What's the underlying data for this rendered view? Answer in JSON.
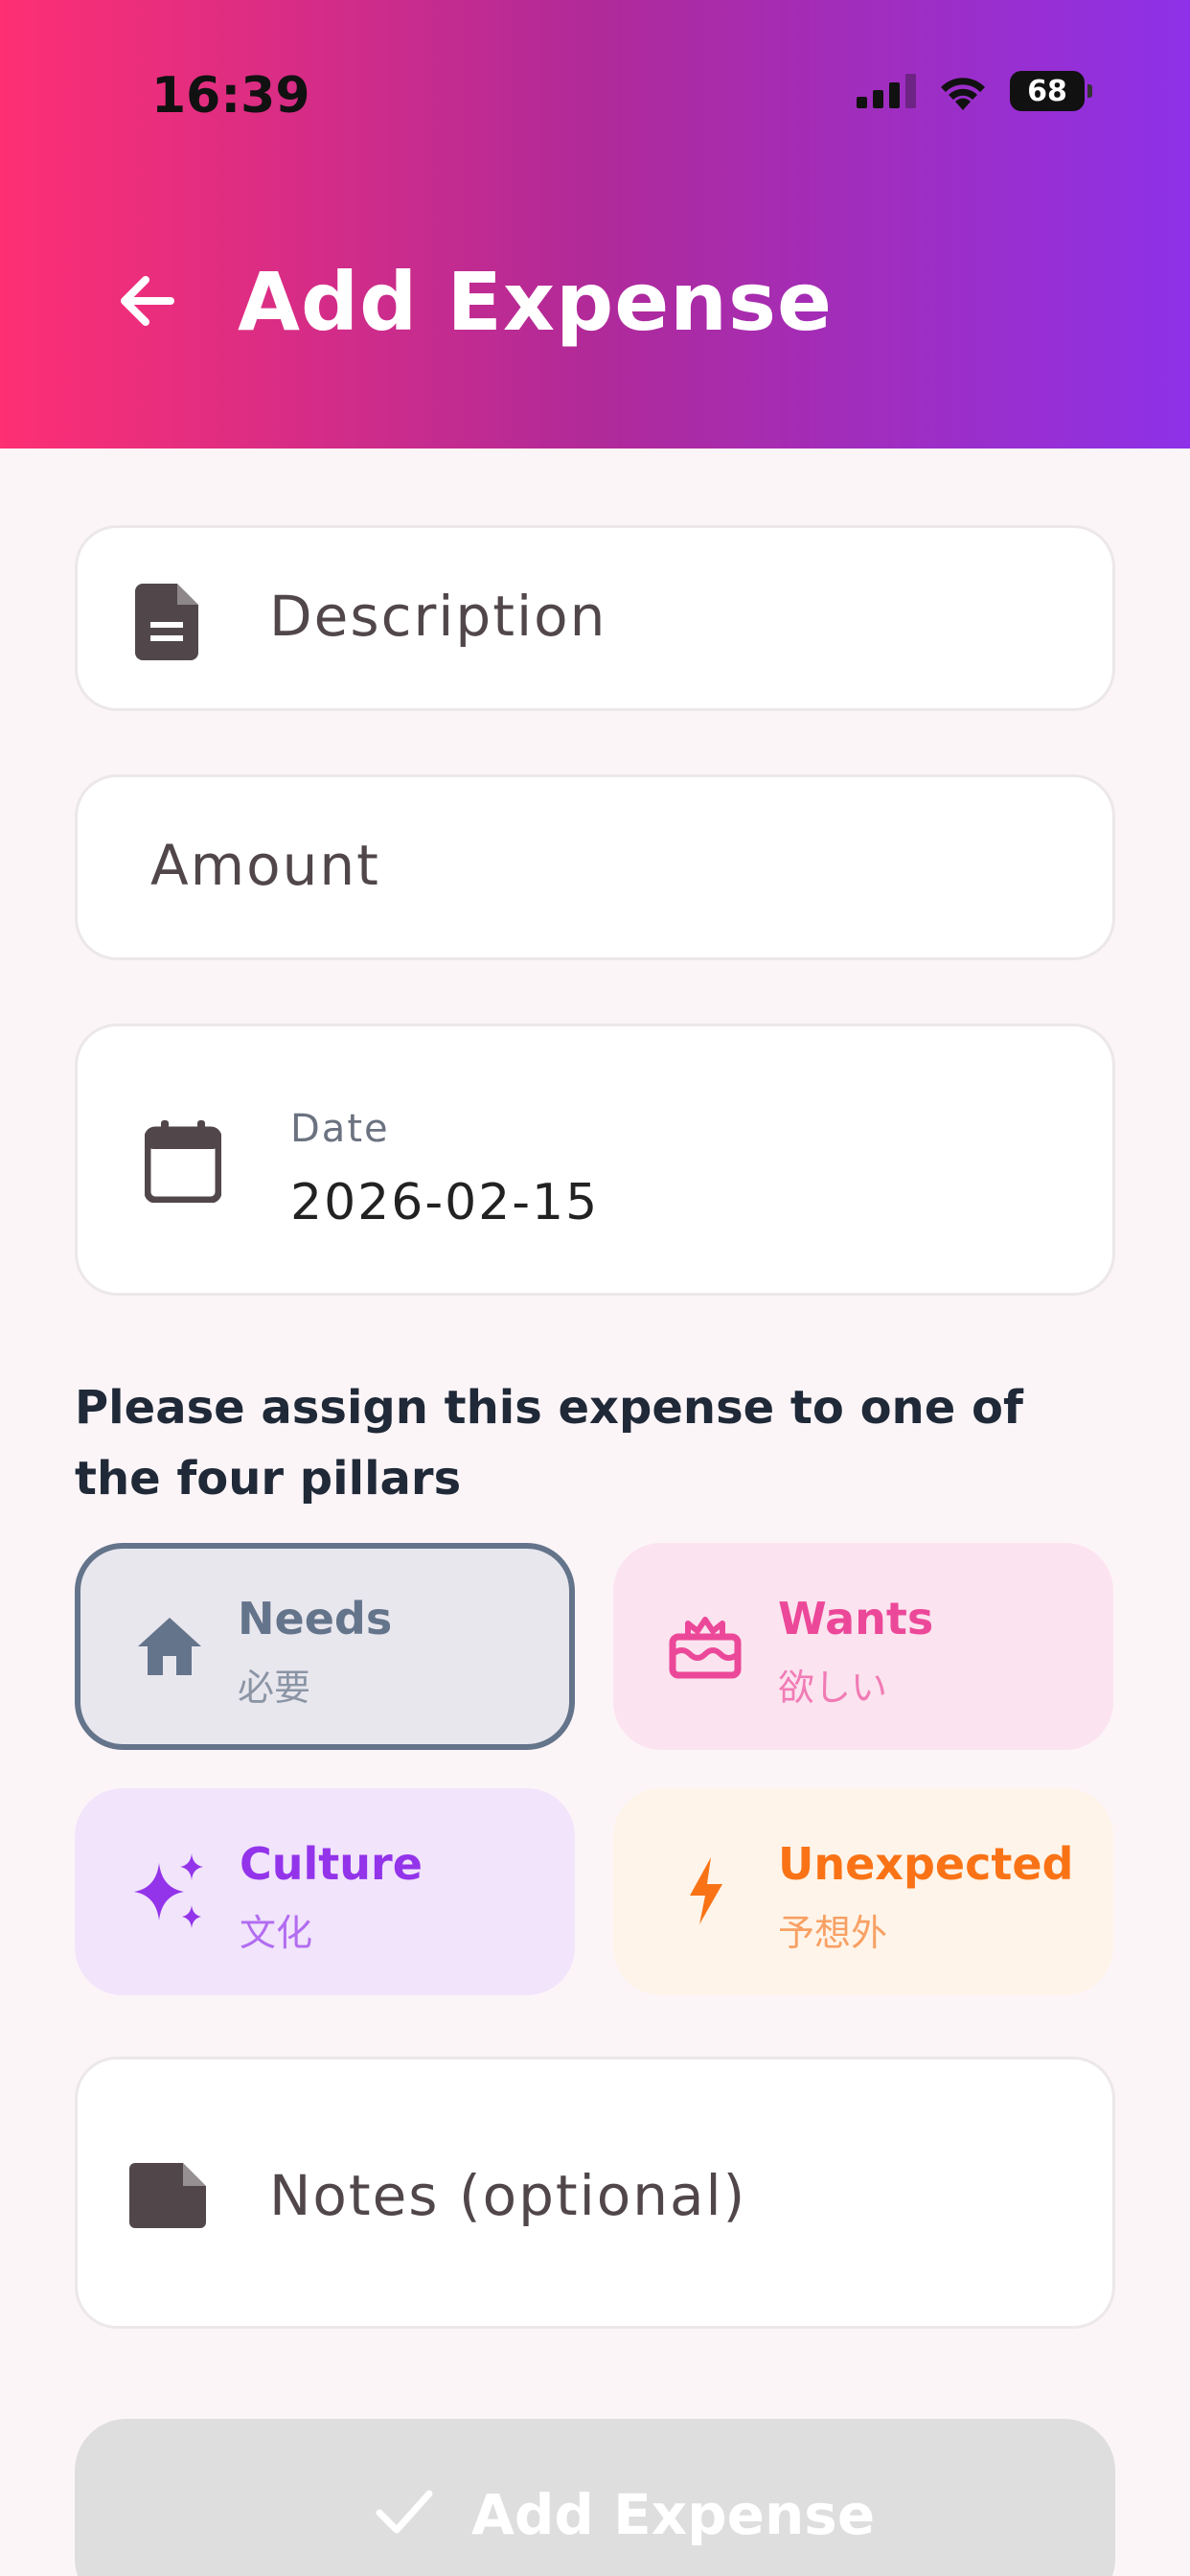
{
  "status_bar": {
    "time": "16:39",
    "battery": "68"
  },
  "header": {
    "title": "Add Expense"
  },
  "form": {
    "description_placeholder": "Description",
    "amount_placeholder": "Amount",
    "date_label": "Date",
    "date_value": "2026-02-15",
    "notes_placeholder": "Notes (optional)"
  },
  "pillars_prompt": "Please assign this expense to one of the four pillars",
  "pillars": [
    {
      "name": "Needs",
      "sub": "必要",
      "color": "#64748b",
      "selected": true
    },
    {
      "name": "Wants",
      "sub": "欲しい",
      "color": "#ec4899",
      "selected": false
    },
    {
      "name": "Culture",
      "sub": "文化",
      "color": "#9333ea",
      "selected": false
    },
    {
      "name": "Unexpected",
      "sub": "予想外",
      "color": "#f97316",
      "selected": false
    }
  ],
  "submit_label": "Add Expense",
  "colors": {
    "header_start": "#fe2f73",
    "header_end": "#8e31e8",
    "background": "#fcf5f8"
  }
}
